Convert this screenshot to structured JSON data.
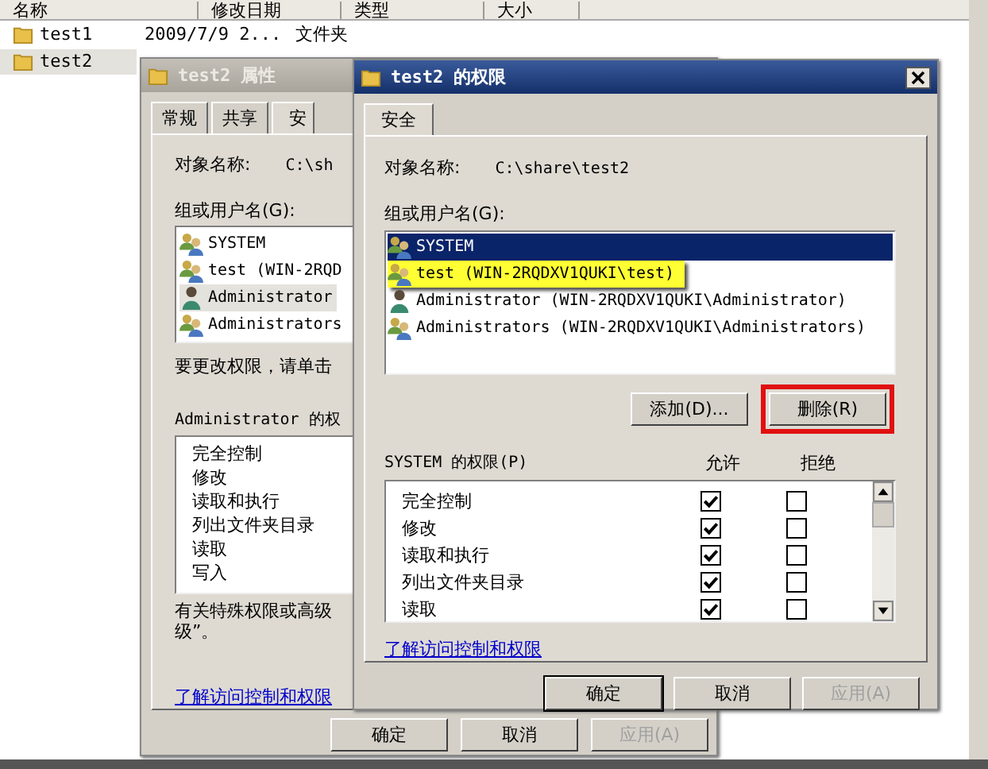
{
  "explorer": {
    "columns": [
      "名称",
      "修改日期",
      "类型",
      "大小"
    ],
    "rows": [
      {
        "name": "test1",
        "date": "2009/7/9 2...",
        "type": "文件夹",
        "selected": false
      },
      {
        "name": "test2",
        "selected": true
      }
    ]
  },
  "properties_window": {
    "title": "test2 属性",
    "active": false,
    "tabs": [
      {
        "label": "常规",
        "selected": false
      },
      {
        "label": "共享",
        "selected": false
      },
      {
        "label": "安",
        "selected": true
      }
    ],
    "object_label": "对象名称:",
    "object_name": "C:\\sh",
    "group_label": "组或用户名(G):",
    "users": [
      {
        "name": "SYSTEM",
        "kind": "group",
        "selected": false
      },
      {
        "name": "test (WIN-2RQD",
        "kind": "group",
        "selected": false
      },
      {
        "name": "Administrator",
        "kind": "user",
        "selected": true
      },
      {
        "name": "Administrators",
        "kind": "group",
        "selected": false
      }
    ],
    "hint": "要更改权限，请单击",
    "perm_label": "Administrator 的权",
    "permissions": [
      "完全控制",
      "修改",
      "读取和执行",
      "列出文件夹目录",
      "读取",
      "写入"
    ],
    "note": [
      "有关特殊权限或高级",
      "级”。"
    ],
    "link": "了解访问控制和权限",
    "buttons": [
      {
        "label": "确定",
        "disabled": false
      },
      {
        "label": "取消",
        "disabled": false
      },
      {
        "label": "应用(A)",
        "disabled": true
      }
    ]
  },
  "permissions_window": {
    "title": "test2 的权限",
    "active": true,
    "tabs": [
      {
        "label": "安全",
        "selected": true
      }
    ],
    "object_label": "对象名称:",
    "object_name": "C:\\share\\test2",
    "group_label": "组或用户名(G):",
    "users": [
      {
        "name": "SYSTEM",
        "kind": "group",
        "selected": true,
        "highlighted": false
      },
      {
        "name": "test (WIN-2RQDXV1QUKI\\test)",
        "kind": "group",
        "selected": false,
        "highlighted": true
      },
      {
        "name": "Administrator (WIN-2RQDXV1QUKI\\Administrator)",
        "kind": "user",
        "selected": false,
        "highlighted": false
      },
      {
        "name": "Administrators (WIN-2RQDXV1QUKI\\Administrators)",
        "kind": "group",
        "selected": false,
        "highlighted": false
      }
    ],
    "user_buttons": [
      {
        "label": "添加(D)...",
        "highlighted": false
      },
      {
        "label": "删除(R)",
        "highlighted": true
      }
    ],
    "perm_label": "SYSTEM 的权限(P)",
    "allow_header": "允许",
    "deny_header": "拒绝",
    "permissions": [
      {
        "name": "完全控制",
        "allow": true,
        "deny": false
      },
      {
        "name": "修改",
        "allow": true,
        "deny": false
      },
      {
        "name": "读取和执行",
        "allow": true,
        "deny": false
      },
      {
        "name": "列出文件夹目录",
        "allow": true,
        "deny": false
      },
      {
        "name": "读取",
        "allow": true,
        "deny": false
      }
    ],
    "link": "了解访问控制和权限",
    "buttons": [
      {
        "label": "确定",
        "disabled": false
      },
      {
        "label": "取消",
        "disabled": false
      },
      {
        "label": "应用(A)",
        "disabled": true
      }
    ]
  }
}
